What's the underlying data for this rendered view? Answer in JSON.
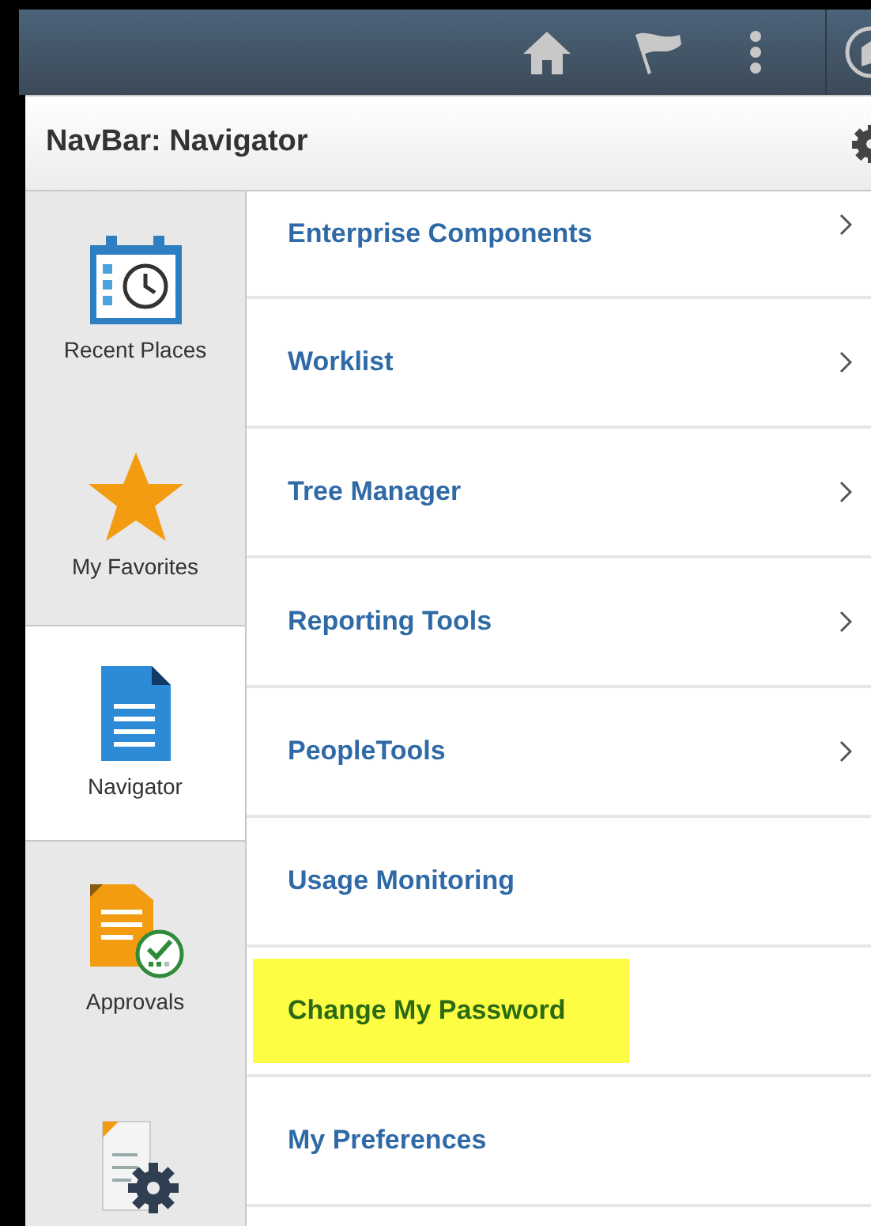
{
  "panel": {
    "title": "NavBar: Navigator"
  },
  "sidebar": {
    "items": [
      {
        "kind": "recent",
        "label": "Recent Places",
        "selected": false
      },
      {
        "kind": "favorites",
        "label": "My Favorites",
        "selected": false
      },
      {
        "kind": "navigator",
        "label": "Navigator",
        "selected": true
      },
      {
        "kind": "approvals",
        "label": "Approvals",
        "selected": false
      },
      {
        "kind": "settings",
        "selected": false
      }
    ]
  },
  "menu": {
    "items": [
      {
        "label": "Enterprise Components",
        "has_children": true,
        "highlighted": false
      },
      {
        "label": "Worklist",
        "has_children": true,
        "highlighted": false
      },
      {
        "label": "Tree Manager",
        "has_children": true,
        "highlighted": false
      },
      {
        "label": "Reporting Tools",
        "has_children": true,
        "highlighted": false
      },
      {
        "label": "PeopleTools",
        "has_children": true,
        "highlighted": false
      },
      {
        "label": "Usage Monitoring",
        "has_children": false,
        "highlighted": false
      },
      {
        "label": "Change My Password",
        "has_children": false,
        "highlighted": true
      },
      {
        "label": "My Preferences",
        "has_children": false,
        "highlighted": false
      }
    ]
  }
}
